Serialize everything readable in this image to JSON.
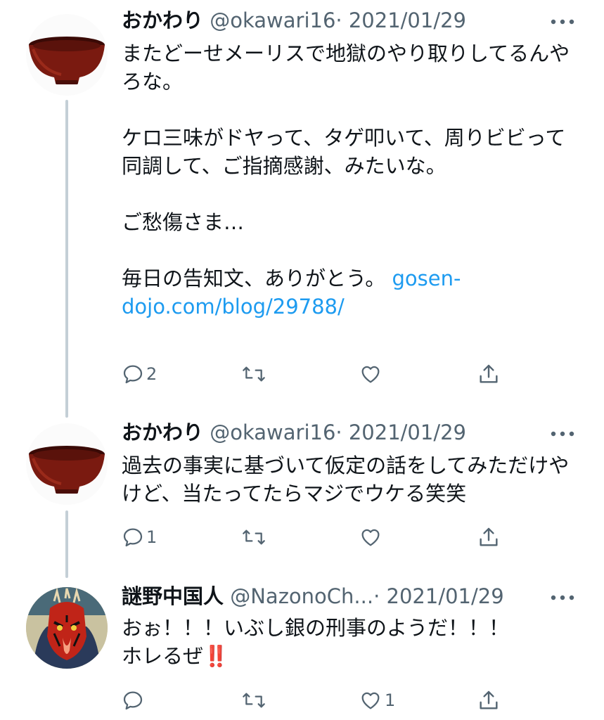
{
  "tweets": [
    {
      "name": "おかわり",
      "handle": "@okawari16",
      "separator": "·",
      "date": "2021/01/29",
      "paragraphs": [
        "またどーせメーリスで地獄のやり取りしてるんやろな。",
        "ケロ三味がドヤって、タゲ叩いて、周りビビって同調して、ご指摘感謝、みたいな。",
        "ご愁傷さま…"
      ],
      "last_paragraph_text": "毎日の告知文、ありがとう。 ",
      "link_text": "gosen-dojo.com/blog/29788/",
      "reply_count": "2",
      "retweet_count": "",
      "like_count": "",
      "avatar_icon": "red-lacquer-bowl-icon"
    },
    {
      "name": "おかわり",
      "handle": "@okawari16",
      "separator": "·",
      "date": "2021/01/29",
      "text": "過去の事実に基づいて仮定の話をしてみただけやけど、当たってたらマジでウケる笑笑",
      "reply_count": "1",
      "retweet_count": "",
      "like_count": "",
      "avatar_icon": "red-lacquer-bowl-icon"
    },
    {
      "name": "謎野中国人",
      "handle": "@NazonoCh...",
      "separator": "·",
      "date": "2021/01/29",
      "line1": "おぉ！！！いぶし銀の刑事のようだ！！！",
      "line2": "ホレるぜ",
      "emoji": "‼️",
      "reply_count": "",
      "retweet_count": "",
      "like_count": "1",
      "avatar_icon": "red-horned-mask-icon"
    }
  ],
  "icons": {
    "reply": "reply-icon",
    "retweet": "retweet-icon",
    "like": "like-icon",
    "share": "share-icon",
    "more": "more-icon"
  },
  "colors": {
    "text": "#0f1419",
    "secondary": "#536471",
    "link": "#1d9bf0",
    "thread_line": "#c4cfd6",
    "bowl": "#7a1a10"
  }
}
